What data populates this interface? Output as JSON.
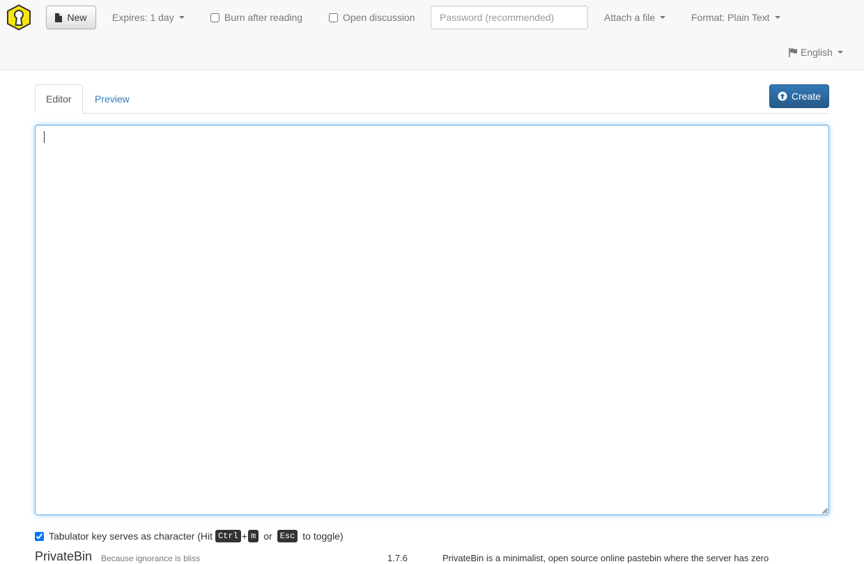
{
  "navbar": {
    "new_label": "New",
    "expires_label": "Expires: 1 day",
    "burn_label": "Burn after reading",
    "burn_checked": false,
    "discussion_label": "Open discussion",
    "discussion_checked": false,
    "password_placeholder": "Password (recommended)",
    "attach_label": "Attach a file",
    "format_label": "Format: Plain Text",
    "language_label": "English"
  },
  "tabs": {
    "editor_label": "Editor",
    "preview_label": "Preview",
    "active": "Editor"
  },
  "create_label": "Create",
  "editor": {
    "value": ""
  },
  "tabkey": {
    "checked": true,
    "text_before": "Tabulator key serves as character (Hit",
    "key1": "Ctrl",
    "plus": "+",
    "key2": "m",
    "or": "or",
    "key3": "Esc",
    "text_after": "to toggle)"
  },
  "footer": {
    "brand": "PrivateBin",
    "tagline": "Because ignorance is bliss",
    "version": "1.7.6",
    "about": "PrivateBin is a minimalist, open source online pastebin where the server has zero"
  },
  "icons": {
    "logo": "keyhole-logo",
    "new": "file-icon",
    "language": "flag-icon",
    "create": "upload-circle-icon"
  },
  "colors": {
    "primary": "#337ab7",
    "link": "#337ab7",
    "logo_fill": "#f5e60e",
    "focus": "#66afe9"
  }
}
